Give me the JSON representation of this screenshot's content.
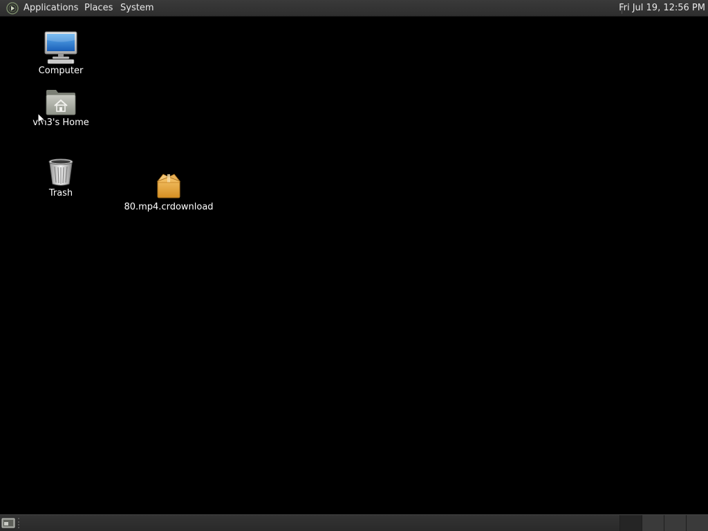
{
  "top_panel": {
    "menus": {
      "applications": "Applications",
      "places": "Places",
      "system": "System"
    },
    "clock": "Fri Jul 19, 12:56 PM"
  },
  "desktop": {
    "icons": [
      {
        "label": "Computer",
        "icon": "computer-icon"
      },
      {
        "label": "vm3's Home",
        "icon": "home-folder-icon"
      },
      {
        "label": "Trash",
        "icon": "trash-icon"
      },
      {
        "label": "80.mp4.crdownload",
        "icon": "package-icon"
      }
    ]
  },
  "bottom_panel": {
    "workspace_count": 4,
    "active_workspace": 1
  },
  "colors": {
    "desktop_background": "#000000",
    "panel": "#2e2e2e",
    "text": "#e8e8e8"
  }
}
